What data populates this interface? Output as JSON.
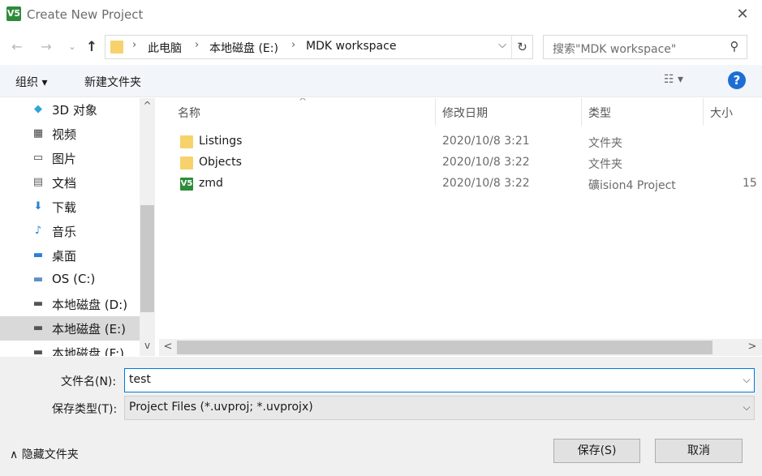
{
  "window": {
    "title": "Create New Project",
    "app_icon": "V5",
    "close_glyph": "✕"
  },
  "address": {
    "back_glyph": "←",
    "forward_glyph": "→",
    "history_glyph": "⌄",
    "up_glyph": "↑",
    "breadcrumb": [
      "此电脑",
      "本地磁盘 (E:)",
      "MDK workspace"
    ],
    "separator": "›",
    "dropdown_glyph": "⌵",
    "refresh_glyph": "↻"
  },
  "search": {
    "placeholder": "搜索\"MDK workspace\"",
    "icon_glyph": "⚲"
  },
  "toolbar": {
    "organize": "组织 ▾",
    "new_folder": "新建文件夹",
    "view": "☷ ▾",
    "help": "?"
  },
  "sidebar": {
    "items": [
      {
        "label": "3D 对象",
        "icon": "cube-icon",
        "glyph": "◆",
        "color": "#2aa7d8"
      },
      {
        "label": "视频",
        "icon": "film-icon",
        "glyph": "▦",
        "color": "#404040"
      },
      {
        "label": "图片",
        "icon": "picture-icon",
        "glyph": "▭",
        "color": "#404040"
      },
      {
        "label": "文档",
        "icon": "document-icon",
        "glyph": "▤",
        "color": "#606060"
      },
      {
        "label": "下载",
        "icon": "download-icon",
        "glyph": "⬇",
        "color": "#2a7fd4"
      },
      {
        "label": "音乐",
        "icon": "music-icon",
        "glyph": "♪",
        "color": "#2a7fd4"
      },
      {
        "label": "桌面",
        "icon": "desktop-icon",
        "glyph": "▬",
        "color": "#2a7fd4"
      },
      {
        "label": "OS (C:)",
        "icon": "windows-drive-icon",
        "glyph": "▬",
        "color": "#5b8ec9"
      },
      {
        "label": "本地磁盘 (D:)",
        "icon": "drive-icon",
        "glyph": "▬",
        "color": "#555555"
      },
      {
        "label": "本地磁盘 (E:)",
        "icon": "drive-icon",
        "glyph": "▬",
        "color": "#555555"
      },
      {
        "label": "本地磁盘 (F:)",
        "icon": "drive-icon",
        "glyph": "▬",
        "color": "#555555"
      }
    ],
    "selected_index": 9,
    "scroll_up_glyph": "^",
    "scroll_down_glyph": "v"
  },
  "files": {
    "columns": [
      "名称",
      "修改日期",
      "类型",
      "大小"
    ],
    "sort_glyph": "^",
    "rows": [
      {
        "name": "Listings",
        "date": "2020/10/8 3:21",
        "type": "文件夹",
        "size": "",
        "icon": "folder-icon"
      },
      {
        "name": "Objects",
        "date": "2020/10/8 3:22",
        "type": "文件夹",
        "size": "",
        "icon": "folder-icon"
      },
      {
        "name": "zmd",
        "date": "2020/10/8 3:22",
        "type": "礦ision4 Project",
        "size": "15",
        "icon": "uvision-project-icon"
      }
    ],
    "hscroll_left_glyph": "<",
    "hscroll_right_glyph": ">"
  },
  "form": {
    "filename_label": "文件名(N):",
    "filename_value": "test",
    "filetype_label": "保存类型(T):",
    "filetype_value": "Project Files (*.uvproj; *.uvprojx)",
    "dropdown_glyph": "⌵"
  },
  "footer": {
    "hide_folders": "∧  隐藏文件夹",
    "save_button": "保存(S)",
    "cancel_button": "取消"
  },
  "colors": {
    "accent": "#0078d7",
    "help": "#1c6ed4",
    "folder": "#f7d26c",
    "uvision": "#2e8b3a"
  }
}
